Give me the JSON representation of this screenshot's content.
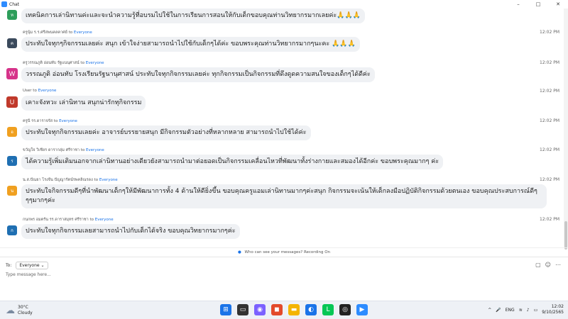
{
  "window": {
    "title": "Chat",
    "controls": [
      "–",
      "□",
      "✕"
    ]
  },
  "messages": [
    {
      "avatar": "ห",
      "avatar_color": "#2e9e5b",
      "sender": "",
      "target": "",
      "time": "",
      "text": "เทคนิคการเล่านิทานค่ะและจะนำความรู้ที่อบรมไปใช้ในการเรียนการสอนให้กับเด็กขอบคุณท่านวิทยากรมากเลยค่ะ🙏🙏🙏"
    },
    {
      "avatar": "ค",
      "avatar_color": "#3b4a5c",
      "sender": "ครูนุ้ม ร.ร.ศรีสพนคลคาศย์",
      "target": "Everyone",
      "time": "12:02 PM",
      "text": "ประทับใจทุกๆกิจกรรมเลยค่ะ สนุก เข้าใจง่ายสามารถนำไปใช้กับเด็กๆได้ค่ะ ขอบพระคุณท่านวิทยากรมากๆนะคะ 🙏🙏🙏"
    },
    {
      "avatar": "W",
      "avatar_color": "#d6338a",
      "sender": "ครูวรรณภูติ อ่อนทับ รัฐแนนุศาสน์",
      "target": "Everyone",
      "time": "12:02 PM",
      "text": "วรรณภูติ อ่อนทับ โรงเรียนรัฐนานุศาสน์ ประทับใจทุกกิจกรรมเลยค่ะ ทุกกิจกรรมเป็นกิจกรรมที่ดึงดูดความสนใจของเด็กๆได้ดีค่ะ"
    },
    {
      "avatar": "U",
      "avatar_color": "#c0392b",
      "sender": "User",
      "target": "Everyone",
      "time": "12:02 PM",
      "text": "เคาะจังหวะ เล่านิทาน สนุกน่ารักทุกิจกรรม"
    },
    {
      "avatar": "อ",
      "avatar_color": "#f0a020",
      "sender": "ครูนี รร.ดาราจรัส",
      "target": "Everyone",
      "time": "12:02 PM",
      "text": "ประทับใจทุกกิจกรรมเลยค่ะ อาจารย์บรรยายสนุก มีกิจกรรมตัวอย่างที่หลากหลาย สามารถนำไปใช้ได้ค่ะ"
    },
    {
      "avatar": "ร",
      "avatar_color": "#1f6fb2",
      "sender": "ขวัญใจ วิเชียร ดารากลุ่ม ศรีราชา",
      "target": "Everyone",
      "time": "12:02 PM",
      "text": "ได้ความรู้เพิ่มเติมนอกจากเล่านิทานอย่างเดียวยังสามารถนำมาต่อยอดเป็นกิจกรรมเคลื่อนไหวที่พัฒนาทั้งร่างกายและสมองได้อีกค่ะ ขอบพระคุณมากๆ ค่ะ"
    },
    {
      "avatar": "น",
      "avatar_color": "#f0a020",
      "sender": "น.ส.ปัณยา โรงจีน ปัญญารัตน์รพคลิณรดง",
      "target": "Everyone",
      "time": "12:02 PM",
      "text": "ประทับใจกิจกรรมดีๆที่นำพัฒนาเด็กๆให้มีพัฒนาการทั้ง 4 ด้านให้ดียิ่งขึ้น ขอบคุณครูแอมเล่านิทานมากๆค่ะสนุก กิจกรรมจะเน้นให้เด็กลงมือปฏิบัติกิจกรรมด้วยตนเอง ขอบคุณประสบการณ์ดีๆๆๆมากๆค่ะ"
    },
    {
      "avatar": "ก",
      "avatar_color": "#1f6fb2",
      "sender": "กนกพร อมตรัน รร.ดาราสมุทร ศรีราชา",
      "target": "Everyone",
      "time": "12:02 PM",
      "text": "ประทับใจทุกกิจกรรมเลยสามารถนำไปกับเด็กได้จริง ขอบคุณวิทยากรมากๆค่ะ"
    }
  ],
  "labels": {
    "to_word": "to"
  },
  "notice": {
    "text": "Who can see your messages? Recording On"
  },
  "composer": {
    "to_label": "To:",
    "recipient": "Everyone",
    "placeholder": "Type message here..."
  },
  "taskbar": {
    "weather_temp": "30°C",
    "weather_desc": "Cloudy",
    "language": "ENG",
    "time": "12:02",
    "date": "9/10/2565"
  }
}
